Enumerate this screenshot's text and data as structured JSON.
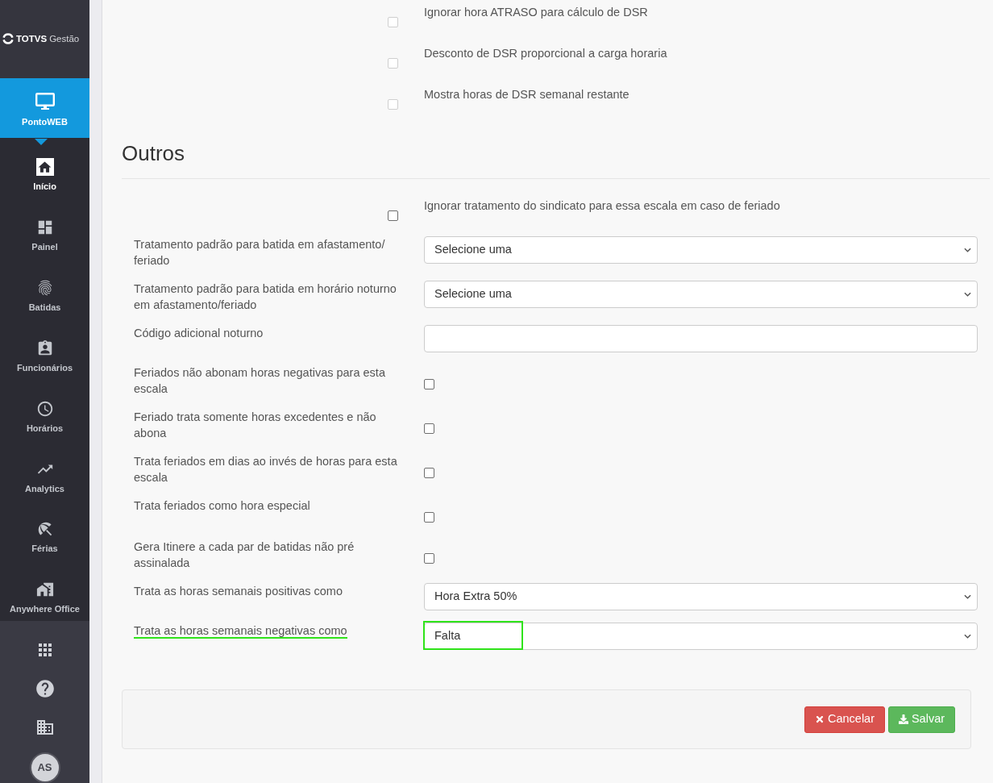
{
  "sidebar": {
    "logo": {
      "brand": "TOTVS",
      "product": "Gestão"
    },
    "module": {
      "label": "PontoWEB"
    },
    "items": [
      {
        "label": "Início",
        "selected": true
      },
      {
        "label": "Painel",
        "selected": false
      },
      {
        "label": "Batidas",
        "selected": false
      },
      {
        "label": "Funcionários",
        "selected": false
      },
      {
        "label": "Horários",
        "selected": false
      },
      {
        "label": "Analytics",
        "selected": false
      },
      {
        "label": "Férias",
        "selected": false
      },
      {
        "label": "Anywhere Office",
        "selected": false
      }
    ],
    "avatar": {
      "initials": "AS"
    }
  },
  "dsr_options": [
    {
      "label": "Ignorar hora ATRASO para cálculo de DSR",
      "checked": false,
      "disabled": true
    },
    {
      "label": "Desconto de DSR proporcional a carga horaria",
      "checked": false,
      "disabled": true
    },
    {
      "label": "Mostra horas de DSR semanal restante",
      "checked": false,
      "disabled": true
    }
  ],
  "others": {
    "title": "Outros",
    "options": [
      {
        "label": "Ignorar tratamento do sindicato para essa escala em caso de feriado",
        "checked": false,
        "disabled": false
      }
    ],
    "fields": [
      {
        "kind": "select",
        "label": "Tratamento padrão para batida em afastamento/feriado",
        "value": "Selecione uma",
        "highlighted": false
      },
      {
        "kind": "select",
        "label": "Tratamento padrão para batida em horário noturno em afastamento/feriado",
        "value": "Selecione uma",
        "highlighted": false
      },
      {
        "kind": "text",
        "label": "Código adicional noturno",
        "highlighted": false
      },
      {
        "kind": "checkbox",
        "label": "Feriados não abonam horas negativas para esta escala",
        "checked": false,
        "highlighted": false
      },
      {
        "kind": "checkbox",
        "label": "Feriado trata somente horas excedentes e não abona",
        "checked": false,
        "highlighted": false
      },
      {
        "kind": "checkbox",
        "label": "Trata feriados em dias ao invés de horas para esta escala",
        "checked": false,
        "highlighted": false
      },
      {
        "kind": "checkbox",
        "label": "Trata feriados como hora especial",
        "checked": false,
        "highlighted": false
      },
      {
        "kind": "checkbox",
        "label": "Gera Itinere a cada par de batidas não pré assinalada",
        "checked": false,
        "highlighted": false
      },
      {
        "kind": "select",
        "label": "Trata as horas semanais positivas como",
        "value": "Hora Extra 50%",
        "highlighted": false
      },
      {
        "kind": "select",
        "label": "Trata as horas semanais negativas como",
        "value": "Falta",
        "highlighted": true
      }
    ]
  },
  "actions": [
    {
      "kind": "cancel",
      "label": "Cancelar"
    },
    {
      "kind": "save",
      "label": "Salvar"
    }
  ]
}
